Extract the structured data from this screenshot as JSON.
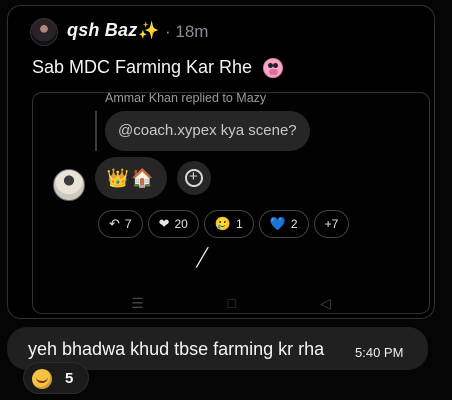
{
  "post": {
    "author": "qsh Baz",
    "author_badge": "✨",
    "timestamp": "· 18m",
    "text": "Sab MDC Farming Kar Rhe",
    "text_emoji_icon": "pig-face-icon"
  },
  "embed": {
    "reply_meta": "Ammar Khan replied to Mazy",
    "quoted_message": "@coach.xypex kya scene?",
    "emoji_bubble": "👑🏠",
    "reactions": [
      {
        "icon": "reply-icon",
        "symbol": "↶",
        "count": "7"
      },
      {
        "icon": "heart-icon",
        "symbol": "❤",
        "count": "20"
      },
      {
        "icon": "face-icon",
        "symbol": "🥲",
        "count": "1"
      },
      {
        "icon": "blue-heart-icon",
        "symbol": "💙",
        "count": "2"
      },
      {
        "icon": "more-icon",
        "symbol": "",
        "count": "+7"
      }
    ],
    "nav_icons": [
      "menu-icon",
      "home-icon",
      "back-icon"
    ]
  },
  "message": {
    "text": "yeh bhadwa khud tbse farming kr rha",
    "time": "5:40 PM"
  },
  "reaction": {
    "icon": "laughing-face-icon",
    "count": "5"
  },
  "colors": {
    "background": "#050505",
    "surface": "#202020",
    "border": "#2f3336"
  }
}
